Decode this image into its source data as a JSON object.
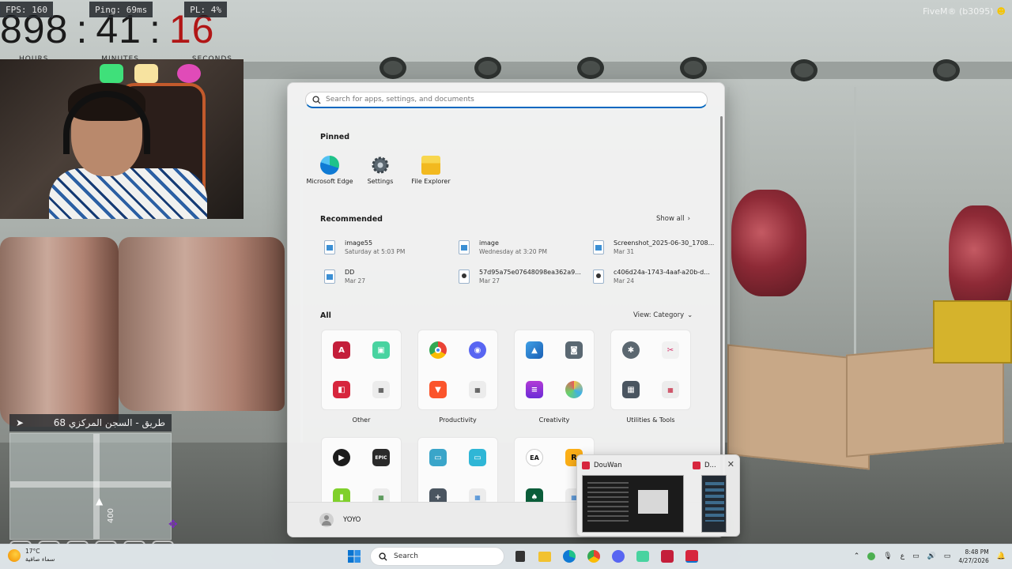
{
  "overlay": {
    "fps": "FPS: 160",
    "ping": "Ping: 69ms",
    "pl": "PL: 4%",
    "timer": {
      "hours": "898",
      "minutes": "41",
      "seconds": "16",
      "sep": ":"
    },
    "timer_labels": {
      "hours": "HOURS",
      "minutes": "MINUTES",
      "seconds": "SECONDS"
    },
    "fivem_tag": "FiveM® (b3095)",
    "location": "68 طريق - السجن المركزي",
    "minimap_scale": "400"
  },
  "start_menu": {
    "search_placeholder": "Search for apps, settings, and documents",
    "pinned_title": "Pinned",
    "pinned": [
      {
        "label": "Microsoft Edge",
        "icon": "edge-icon",
        "color": "#0f7ad4"
      },
      {
        "label": "Settings",
        "icon": "gear-icon",
        "color": "#5b6770"
      },
      {
        "label": "File Explorer",
        "icon": "folder-icon",
        "color": "#f2c230"
      }
    ],
    "recommended_title": "Recommended",
    "show_all": "Show all",
    "recommended": [
      {
        "name": "image55",
        "meta": "Saturday at 5:03 PM",
        "kind": "img"
      },
      {
        "name": "image",
        "meta": "Wednesday at 3:20 PM",
        "kind": "img"
      },
      {
        "name": "Screenshot_2025-06-30_1708...",
        "meta": "Mar 31",
        "kind": "img"
      },
      {
        "name": "DD",
        "meta": "Mar 27",
        "kind": "img"
      },
      {
        "name": "57d95a75e07648098ea362a9...",
        "meta": "Mar 27",
        "kind": "vid"
      },
      {
        "name": "c406d24a-1743-4aaf-a20b-d...",
        "meta": "Mar 24",
        "kind": "vid"
      }
    ],
    "all_title": "All",
    "view_label": "View: Category",
    "categories": [
      {
        "name": "Other"
      },
      {
        "name": "Productivity"
      },
      {
        "name": "Creativity"
      },
      {
        "name": "Utilities & Tools"
      }
    ],
    "user": "YOYO"
  },
  "preview": {
    "app1": "DouWan",
    "app2": "D..."
  },
  "taskbar": {
    "temp": "17°C",
    "weather_desc": "سماء صافية",
    "search": "Search",
    "lang": "ع",
    "time": "8:48 PM",
    "date": "4/27/2026"
  }
}
